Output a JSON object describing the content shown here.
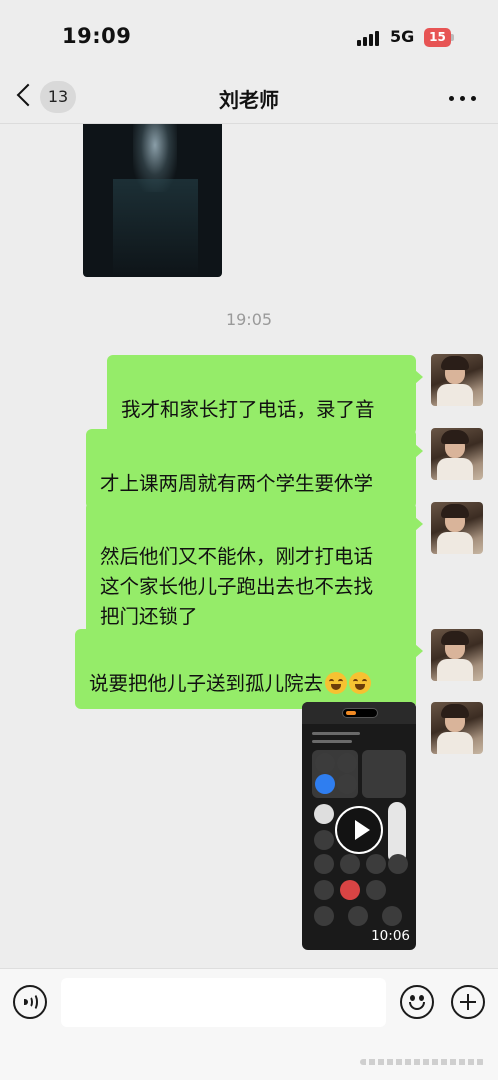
{
  "status_bar": {
    "time": "19:09",
    "network": "5G",
    "battery": "15",
    "battery_color": "#e75454"
  },
  "nav": {
    "unread_count": "13",
    "title": "刘老师",
    "back_icon": "chevron-left-icon",
    "more_icon": "more-dots-icon"
  },
  "chat": {
    "timestamp": "19:05",
    "messages": [
      {
        "type": "image",
        "from": "me"
      },
      {
        "type": "text",
        "from": "me",
        "text": "我才和家长打了电话，录了音"
      },
      {
        "type": "text",
        "from": "me",
        "text": "才上课两周就有两个学生要休学"
      },
      {
        "type": "text",
        "from": "me",
        "text": "然后他们又不能休，刚才打电话\n这个家长他儿子跑出去也不去找\n把门还锁了"
      },
      {
        "type": "text",
        "from": "me",
        "text": "说要把他儿子送到孤儿院去",
        "emojis": [
          "laugh-cry-emoji",
          "laugh-cry-emoji"
        ]
      },
      {
        "type": "video",
        "from": "me",
        "duration": "10:06"
      }
    ],
    "bubble_color": "#95ec69"
  },
  "input_bar": {
    "voice_icon": "voice-icon",
    "text_value": "",
    "emoji_icon": "smile-icon",
    "plus_icon": "plus-icon"
  }
}
